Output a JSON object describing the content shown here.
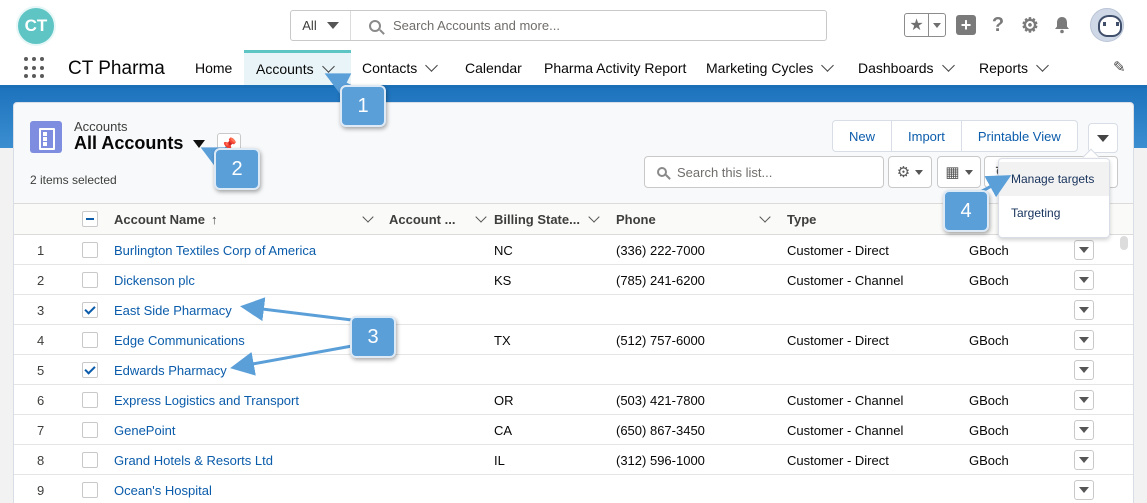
{
  "header": {
    "logo_text": "CT",
    "search_scope": "All",
    "search_placeholder": "Search Accounts and more..."
  },
  "nav": {
    "app_name": "CT Pharma",
    "items": [
      {
        "label": "Home",
        "has_menu": false
      },
      {
        "label": "Accounts",
        "has_menu": true,
        "active": true
      },
      {
        "label": "Contacts",
        "has_menu": true
      },
      {
        "label": "Calendar",
        "has_menu": false
      },
      {
        "label": "Pharma Activity Report",
        "has_menu": false
      },
      {
        "label": "Marketing Cycles",
        "has_menu": true
      },
      {
        "label": "Dashboards",
        "has_menu": true
      },
      {
        "label": "Reports",
        "has_menu": true
      }
    ]
  },
  "list_header": {
    "object_label": "Accounts",
    "view_name": "All Accounts",
    "selection_status": "2 items selected",
    "buttons": [
      "New",
      "Import",
      "Printable View"
    ],
    "search_placeholder": "Search this list..."
  },
  "table": {
    "columns": [
      "Account Name",
      "Account ...",
      "Billing State...",
      "Phone",
      "Type"
    ],
    "sort_indicator": "↑",
    "rows": [
      {
        "num": "1",
        "name": "Burlington Textiles Corp of America",
        "state": "NC",
        "phone": "(336) 222-7000",
        "type": "Customer - Direct",
        "owner": "GBoch",
        "checked": false
      },
      {
        "num": "2",
        "name": "Dickenson plc",
        "state": "KS",
        "phone": "(785) 241-6200",
        "type": "Customer - Channel",
        "owner": "GBoch",
        "checked": false
      },
      {
        "num": "3",
        "name": "East Side Pharmacy",
        "state": "",
        "phone": "",
        "type": "",
        "owner": "",
        "checked": true
      },
      {
        "num": "4",
        "name": "Edge Communications",
        "state": "TX",
        "phone": "(512) 757-6000",
        "type": "Customer - Direct",
        "owner": "GBoch",
        "checked": false
      },
      {
        "num": "5",
        "name": "Edwards Pharmacy",
        "state": "",
        "phone": "",
        "type": "",
        "owner": "",
        "checked": true
      },
      {
        "num": "6",
        "name": "Express Logistics and Transport",
        "state": "OR",
        "phone": "(503) 421-7800",
        "type": "Customer - Channel",
        "owner": "GBoch",
        "checked": false
      },
      {
        "num": "7",
        "name": "GenePoint",
        "state": "CA",
        "phone": "(650) 867-3450",
        "type": "Customer - Channel",
        "owner": "GBoch",
        "checked": false
      },
      {
        "num": "8",
        "name": "Grand Hotels & Resorts Ltd",
        "state": "IL",
        "phone": "(312) 596-1000",
        "type": "Customer - Direct",
        "owner": "GBoch",
        "checked": false
      },
      {
        "num": "9",
        "name": "Ocean's Hospital",
        "state": "",
        "phone": "",
        "type": "",
        "owner": "",
        "checked": false
      }
    ]
  },
  "dropdown_menu": {
    "items": [
      "Manage targets",
      "Targeting"
    ]
  },
  "callouts": [
    "1",
    "2",
    "3",
    "4"
  ],
  "colors": {
    "brand_teal": "#5ec5c4",
    "link_blue": "#0b5cab",
    "banner_blue": "#1d73bd",
    "callout_blue": "#5b9fd9"
  }
}
